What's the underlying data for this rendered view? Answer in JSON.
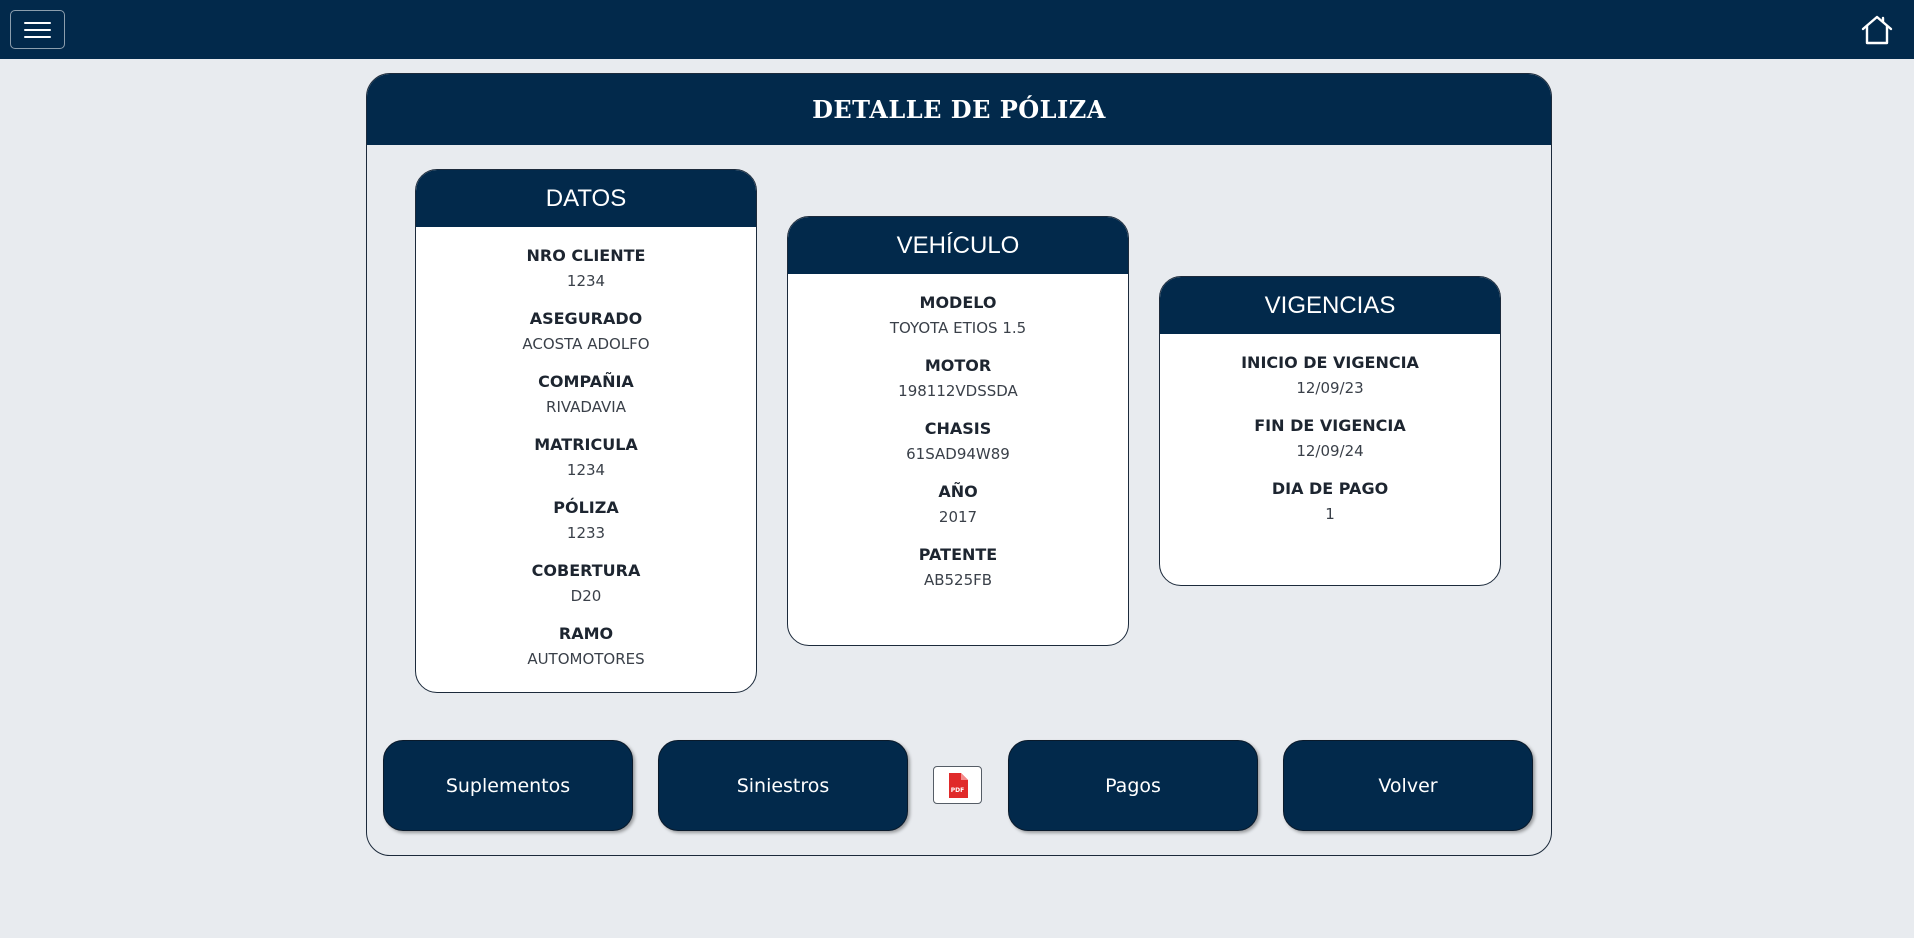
{
  "navbar": {
    "menu_icon": "hamburger-menu-icon",
    "home_icon": "home-icon",
    "background": "#02294b"
  },
  "title": "DETALLE DE PÓLIZA",
  "datos": {
    "title": "DATOS",
    "fields": [
      {
        "label": "NRO CLIENTE",
        "value": "1234"
      },
      {
        "label": "ASEGURADO",
        "value": "ACOSTA ADOLFO"
      },
      {
        "label": "COMPAÑIA",
        "value": "RIVADAVIA"
      },
      {
        "label": "MATRICULA",
        "value": "1234"
      },
      {
        "label": "PÓLIZA",
        "value": "1233"
      },
      {
        "label": "COBERTURA",
        "value": "D20"
      },
      {
        "label": "RAMO",
        "value": "AUTOMOTORES"
      }
    ]
  },
  "vehiculo": {
    "title": "VEHÍCULO",
    "fields": [
      {
        "label": "MODELO",
        "value": "TOYOTA ETIOS 1.5"
      },
      {
        "label": "MOTOR",
        "value": "198112VDSSDA"
      },
      {
        "label": "CHASIS",
        "value": "61SAD94W89"
      },
      {
        "label": "AÑO",
        "value": "2017"
      },
      {
        "label": "PATENTE",
        "value": "AB525FB"
      }
    ]
  },
  "vigencias": {
    "title": "VIGENCIAS",
    "fields": [
      {
        "label": "INICIO DE VIGENCIA",
        "value": "12/09/23"
      },
      {
        "label": "FIN DE VIGENCIA",
        "value": "12/09/24"
      },
      {
        "label": "DIA DE PAGO",
        "value": "1"
      }
    ]
  },
  "buttons": {
    "suplementos": "Suplementos",
    "siniestros": "Siniestros",
    "pagos": "Pagos",
    "volver": "Volver",
    "pdf_icon": "pdf-file-icon",
    "pdf_label": "PDF"
  },
  "colors": {
    "primary": "#02294b",
    "page_background": "#e8ebef",
    "pdf_red": "#e02a2a"
  }
}
